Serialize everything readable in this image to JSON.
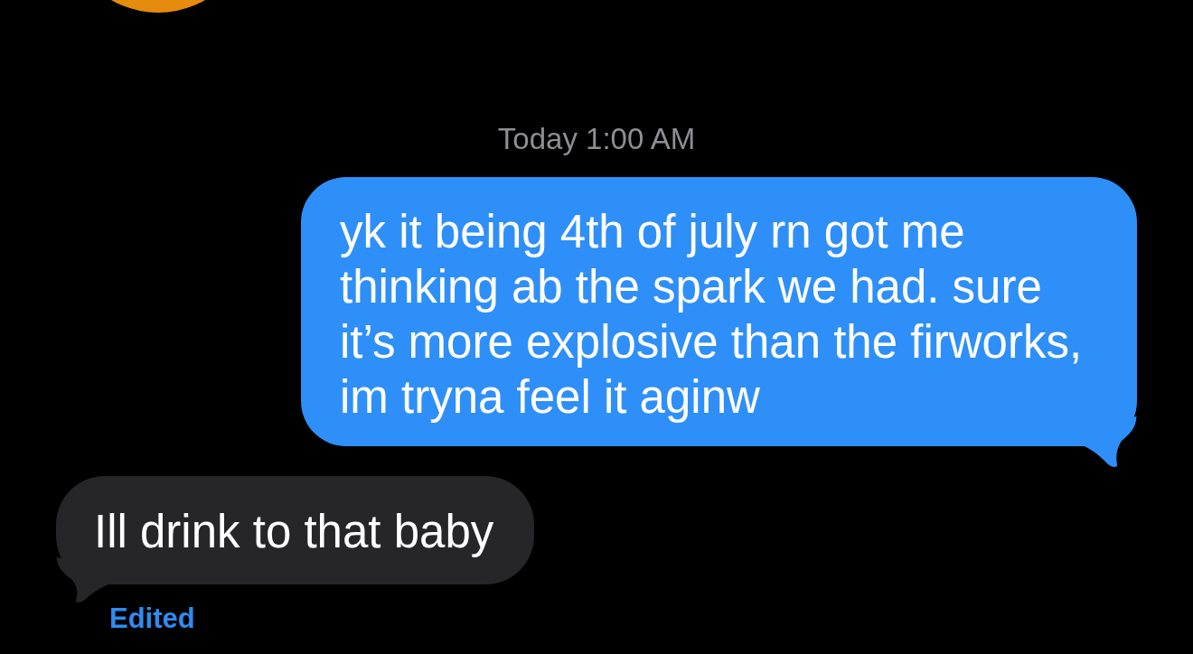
{
  "timestamp": "Today 1:00 AM",
  "messages": [
    {
      "kind": "sent",
      "text": "yk it being 4th of july rn got me thinking ab the spark we had. sure it’s more explosive than the firworks, im tryna feel it aginw"
    },
    {
      "kind": "received",
      "text": "Ill drink to that baby",
      "edited_label": "Edited"
    }
  ]
}
